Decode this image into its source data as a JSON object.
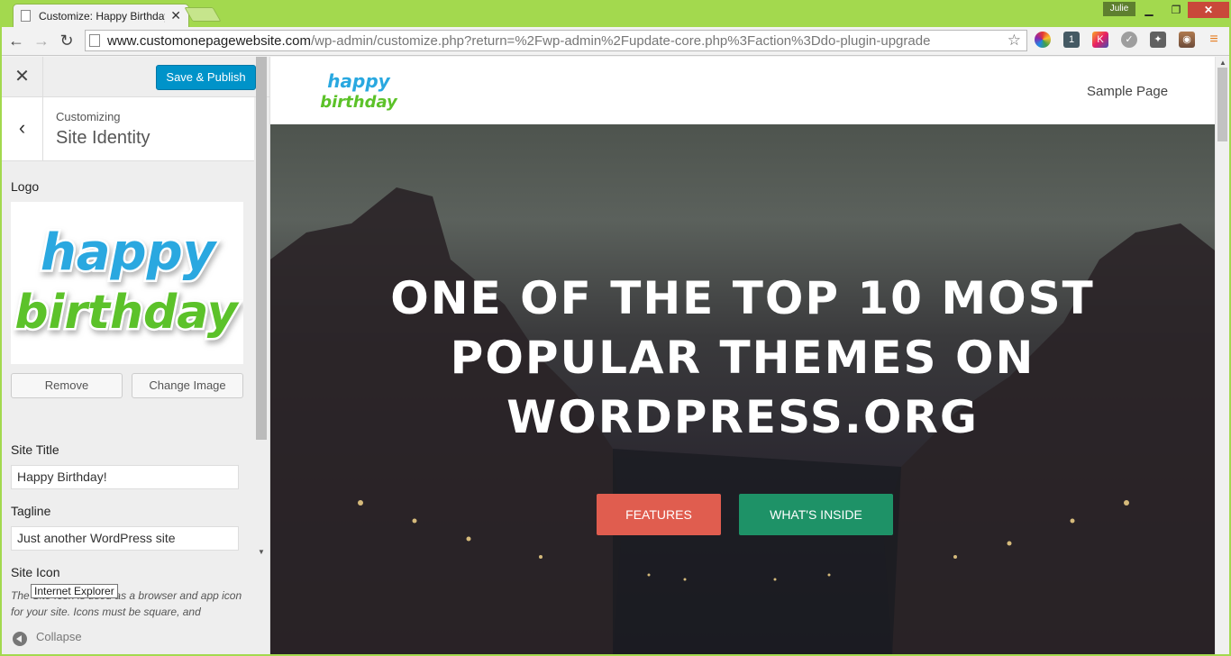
{
  "browser": {
    "tab_title": "Customize: Happy Birthday!",
    "tab_close": "✕",
    "user_badge": "Julie",
    "url_host": "www.customonepagewebsite.com",
    "url_path": "/wp-admin/customize.php?return=%2Fwp-admin%2Fupdate-core.php%3Faction%3Ddo-plugin-upgrade",
    "ext_badge": "1",
    "ext_k": "K"
  },
  "customizer": {
    "close_label": "✕",
    "publish_label": "Save & Publish",
    "back_label": "‹",
    "customizing_label": "Customizing",
    "section_title": "Site Identity",
    "logo_label": "Logo",
    "logo_text_line1": "happy",
    "logo_text_line2": "birthday",
    "remove_label": "Remove",
    "change_image_label": "Change Image",
    "site_title_label": "Site Title",
    "site_title_value": "Happy Birthday!",
    "tagline_label": "Tagline",
    "tagline_value": "Just another WordPress site",
    "site_icon_label": "Site Icon",
    "site_icon_desc": "The Site Icon is used as a browser and app icon for your site. Icons must be square, and",
    "collapse_label": "Collapse",
    "tooltip": "Internet Explorer"
  },
  "preview": {
    "nav_item": "Sample Page",
    "hero_title": "ONE OF THE TOP 10 MOST POPULAR THEMES ON WORDPRESS.ORG",
    "features_label": "FEATURES",
    "inside_label": "WHAT'S INSIDE"
  },
  "colors": {
    "frame": "#a3d94e",
    "publish": "#0093c9",
    "features": "#e05d4f",
    "inside": "#1e9267",
    "logo_blue": "#29a8e0",
    "logo_green": "#5cc229"
  }
}
